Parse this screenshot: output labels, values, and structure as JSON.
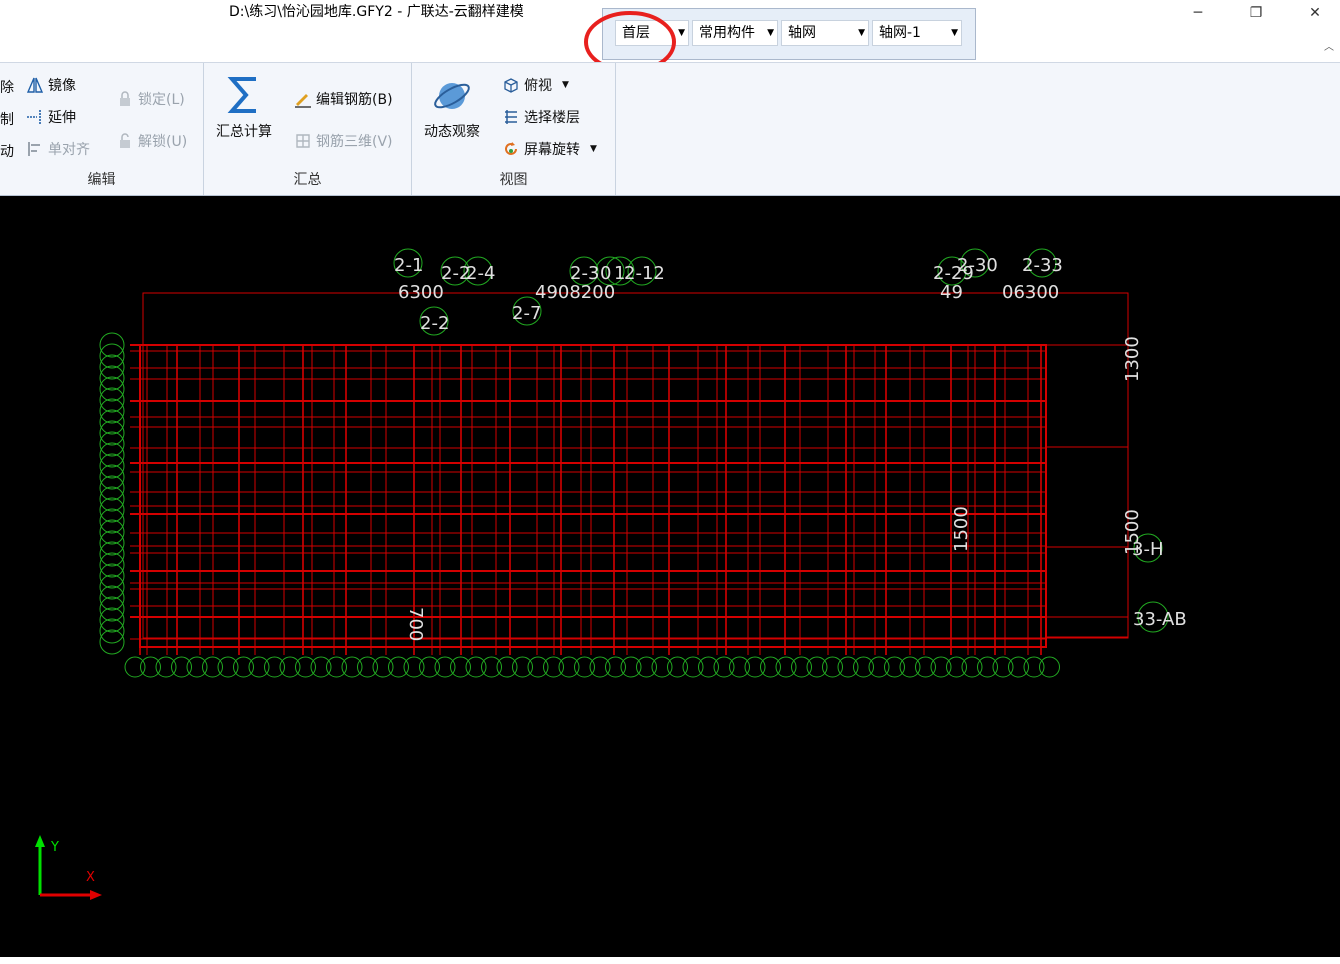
{
  "window": {
    "title": "D:\\练习\\怡沁园地库.GFY2 - 广联达-云翻样建模",
    "minimize_glyph": "─",
    "maximize_glyph": "❐",
    "close_glyph": "✕"
  },
  "selector": {
    "floor": "首层",
    "category": "常用构件",
    "component_type": "轴网",
    "component": "轴网-1"
  },
  "ribbon": {
    "edit_group": {
      "label": "编辑",
      "partial_left": [
        "除",
        "制",
        "动"
      ],
      "mirror": "镜像",
      "extend": "延伸",
      "single_align": "单对齐",
      "lock": "锁定(L)",
      "unlock": "解锁(U)"
    },
    "summary_group": {
      "label": "汇总",
      "summary_calc": "汇总计算",
      "edit_rebar": "编辑钢筋(B)",
      "rebar_3d": "钢筋三维(V)"
    },
    "view_group": {
      "label": "视图",
      "dynamic_observe": "动态观察",
      "top_view": "俯视",
      "select_floor": "选择楼层",
      "screen_rotate": "屏幕旋转"
    }
  },
  "canvas": {
    "top_axis_labels": [
      "2-1",
      "2-2",
      "2-4",
      "2-3",
      "0",
      "1",
      "2-12",
      "2-7",
      "2-2",
      "2-29",
      "2-30",
      "2-33"
    ],
    "top_dimensions": [
      "6300",
      "4908200",
      "49",
      "06300"
    ],
    "right_labels": [
      "3-H",
      "33-AB"
    ],
    "right_dimensions": [
      "1300",
      "1500"
    ],
    "inner_dimensions": [
      "1500",
      "700"
    ],
    "axis_y": "Y",
    "axis_x": "X",
    "colors": {
      "grid": "#d40000",
      "axis_bubble": "#22aa22",
      "dim_text": "#e0e0e0"
    }
  }
}
